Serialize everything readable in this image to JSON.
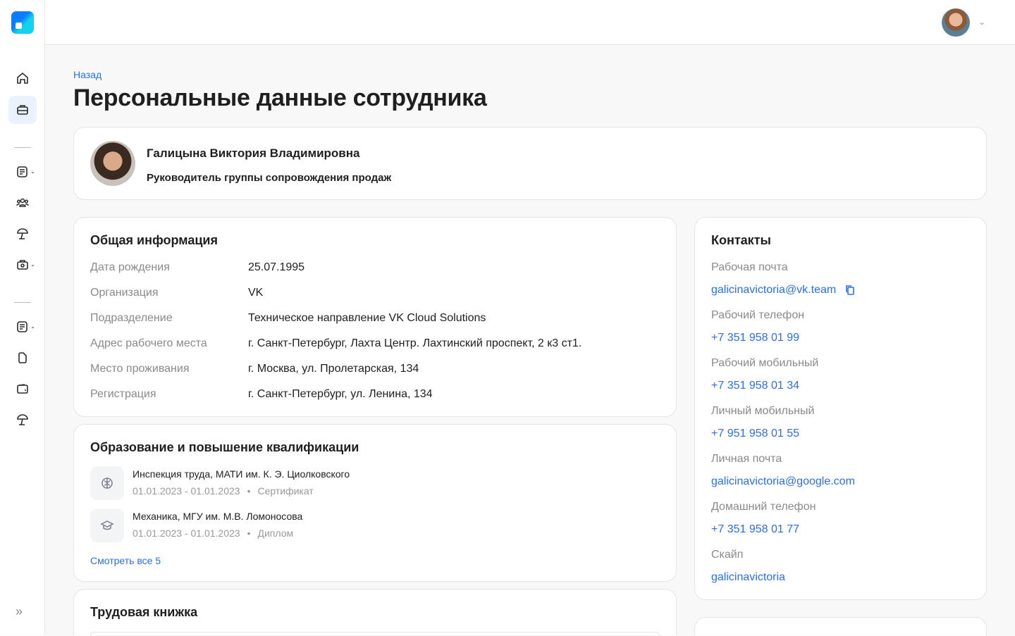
{
  "header": {
    "user_menu": "user-avatar"
  },
  "nav": {
    "back": "Назад",
    "title": "Персональные данные сотрудника"
  },
  "profile": {
    "name": "Галицына Виктория Владимировна",
    "position": "Руководитель группы сопровождения продаж"
  },
  "general": {
    "title": "Общая информация",
    "rows": [
      {
        "label": "Дата рождения",
        "value": "25.07.1995"
      },
      {
        "label": "Организация",
        "value": "VK"
      },
      {
        "label": "Подразделение",
        "value": "Техническое направление VK Cloud Solutions"
      },
      {
        "label": "Адрес рабочего места",
        "value": "г. Санкт-Петербург, Лахта Центр. Лахтинский проспект, 2 к3 ст1."
      },
      {
        "label": "Место проживания",
        "value": "г. Москва, ул. Пролетарская, 134"
      },
      {
        "label": "Регистрация",
        "value": "г. Санкт-Петербург, ул. Ленина, 134"
      }
    ]
  },
  "education": {
    "title": "Образование и повышение квалификации",
    "items": [
      {
        "title": "Инспекция труда, МАТИ им. К. Э. Циолковского",
        "dates": "01.01.2023 - 01.01.2023",
        "type": "Сертификат",
        "icon": "brain-icon"
      },
      {
        "title": "Механика, МГУ им. М.В. Ломоносова",
        "dates": "01.01.2023 - 01.01.2023",
        "type": "Диплом",
        "icon": "graduation-cap-icon"
      }
    ],
    "see_all": "Смотреть все 5",
    "bullet": "•"
  },
  "work": {
    "title": "Трудовая книжка"
  },
  "contacts": {
    "title": "Контакты",
    "items": [
      {
        "label": "Рабочая почта",
        "value": "galicinavictoria@vk.team"
      },
      {
        "label": "Рабочий телефон",
        "value": "+7 351 958 01 99"
      },
      {
        "label": "Рабочий мобильный",
        "value": "+7 351 958 01 34"
      },
      {
        "label": "Личный мобильный",
        "value": "+7 951 958 01 55"
      },
      {
        "label": "Личная почта",
        "value": "galicinavictoria@google.com"
      },
      {
        "label": "Домашний телефон",
        "value": "+7 351 958 01 77"
      },
      {
        "label": "Скайп",
        "value": "galicinavictoria"
      }
    ]
  },
  "colors": {
    "accent": "#2a6ff0",
    "active_bg": "#ebf2fd"
  }
}
